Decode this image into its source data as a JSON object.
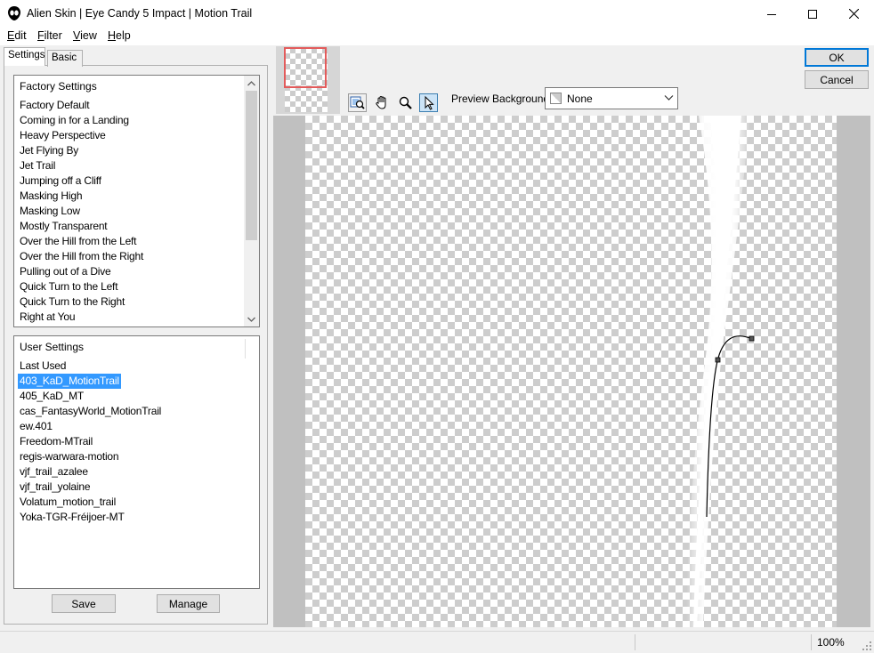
{
  "window": {
    "title": "Alien Skin | Eye Candy 5 Impact | Motion Trail",
    "controls": [
      "minimize-icon",
      "maximize-icon",
      "close-icon"
    ]
  },
  "menu": {
    "edit": {
      "u": "E",
      "rest": "dit"
    },
    "filter": {
      "u": "F",
      "rest": "ilter"
    },
    "view": {
      "u": "V",
      "rest": "iew"
    },
    "help": {
      "u": "H",
      "rest": "elp"
    }
  },
  "tabs": {
    "settings": "Settings",
    "basic": "Basic"
  },
  "factory": {
    "header": "Factory Settings",
    "items": [
      "Factory Default",
      "Coming in for a Landing",
      "Heavy Perspective",
      "Jet Flying By",
      "Jet Trail",
      "Jumping off a Cliff",
      "Masking High",
      "Masking Low",
      "Mostly Transparent",
      "Over the Hill from the Left",
      "Over the Hill from the Right",
      "Pulling out of a Dive",
      "Quick Turn to the Left",
      "Quick Turn to the Right",
      "Right at You"
    ]
  },
  "user": {
    "header": "User Settings",
    "items": [
      "Last Used",
      "403_KaD_MotionTrail",
      "405_KaD_MT",
      "cas_FantasyWorld_MotionTrail",
      "ew.401",
      "Freedom-MTrail",
      "regis-warwara-motion",
      "vjf_trail_azalee",
      "vjf_trail_yolaine",
      "Volatum_motion_trail",
      "Yoka-TGR-Fréijoer-MT"
    ],
    "selected": "403_KaD_MotionTrail"
  },
  "buttons": {
    "save": "Save",
    "manage": "Manage",
    "ok": "OK",
    "cancel": "Cancel"
  },
  "toolbar": {
    "tools": [
      "zoom-to-fit-icon",
      "hand-icon",
      "zoom-icon",
      "pointer-icon"
    ],
    "active_tool": "pointer-icon",
    "preview_background_label": "Preview Background:",
    "preview_background_value": "None"
  },
  "status": {
    "zoom": "100%"
  },
  "colors": {
    "accent": "#0078d7",
    "selection": "#3399ff",
    "navigator_frame": "#e35b5b"
  }
}
